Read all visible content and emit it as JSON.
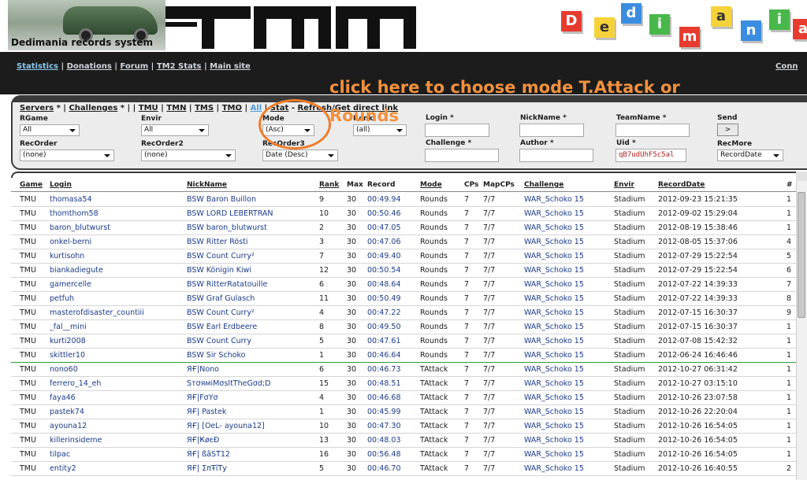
{
  "header": {
    "title": "Dedimania records system",
    "logo_text": "TMN",
    "dedimania_letters": [
      "D",
      "e",
      "d",
      "i",
      "m",
      "a",
      "n",
      "i",
      "a"
    ]
  },
  "nav": {
    "links": [
      "Statistics",
      "Donations",
      "Forum",
      "TM2 Stats",
      "Main site"
    ],
    "active": "Statistics",
    "right_link": "Conn"
  },
  "annotation": {
    "text": "click here to choose mode T.Attack or Rounds",
    "color": "#f2913d"
  },
  "panel": {
    "servers_label": "Servers",
    "challenges_label": "Challenges",
    "games": [
      "TMU",
      "TMN",
      "TMS",
      "TMO",
      "All"
    ],
    "current_game": "All",
    "stat_label": "Stat",
    "refresh_label": "Refresh/Get direct link",
    "filters": {
      "rgame": {
        "label": "RGame",
        "value": "All"
      },
      "envir": {
        "label": "Envir",
        "value": "All"
      },
      "mode": {
        "label": "Mode",
        "value": "(Asc)"
      },
      "rank": {
        "label": "Rank",
        "value": "(all)"
      },
      "login": {
        "label": "Login *",
        "value": ""
      },
      "nickname": {
        "label": "NickName *",
        "value": ""
      },
      "teamname": {
        "label": "TeamName *",
        "value": ""
      },
      "send": {
        "label": "Send",
        "button": ">"
      },
      "recorder": {
        "label": "RecOrder",
        "value": "(none)"
      },
      "recorder2": {
        "label": "RecOrder2",
        "value": "(none)"
      },
      "recorder3": {
        "label": "RecOrder3",
        "value": "Date (Desc)"
      },
      "challenge": {
        "label": "Challenge *",
        "value": ""
      },
      "author": {
        "label": "Author *",
        "value": ""
      },
      "uid": {
        "label": "Uid *",
        "value": "qB7udUhF5c5al"
      },
      "recmore": {
        "label": "RecMore",
        "value": "RecordDate"
      }
    }
  },
  "table": {
    "columns": [
      "Game",
      "Login",
      "NickName",
      "Rank",
      "Max",
      "Record",
      "Mode",
      "CPs",
      "MapCPs",
      "Challenge",
      "Envir",
      "RecordDate",
      "#"
    ],
    "rows": [
      [
        "TMU",
        "thomasa54",
        "BSW Baron Buillon",
        "9",
        "30",
        "00:49.94",
        "Rounds",
        "7",
        "7/7",
        "WAR_Schoko 15",
        "Stadium",
        "2012-09-23 15:21:35",
        "1"
      ],
      [
        "TMU",
        "thomthom58",
        "BSW LORD LEBERTRAN",
        "10",
        "30",
        "00:50.46",
        "Rounds",
        "7",
        "7/7",
        "WAR_Schoko 15",
        "Stadium",
        "2012-09-02 15:29:04",
        "1"
      ],
      [
        "TMU",
        "baron_blutwurst",
        "BSW baron_blutwurst",
        "2",
        "30",
        "00:47.05",
        "Rounds",
        "7",
        "7/7",
        "WAR_Schoko 15",
        "Stadium",
        "2012-08-19 15:38:46",
        "1"
      ],
      [
        "TMU",
        "onkel-berni",
        "BSW Ritter Rösti",
        "3",
        "30",
        "00:47.06",
        "Rounds",
        "7",
        "7/7",
        "WAR_Schoko 15",
        "Stadium",
        "2012-08-05 15:37:06",
        "4"
      ],
      [
        "TMU",
        "kurtisohn",
        "BSW Count Curry²",
        "7",
        "30",
        "00:49.40",
        "Rounds",
        "7",
        "7/7",
        "WAR_Schoko 15",
        "Stadium",
        "2012-07-29 15:22:54",
        "5"
      ],
      [
        "TMU",
        "biankadiegute",
        "BSW Königin Kiwi",
        "12",
        "30",
        "00:50.54",
        "Rounds",
        "7",
        "7/7",
        "WAR_Schoko 15",
        "Stadium",
        "2012-07-29 15:22:54",
        "6"
      ],
      [
        "TMU",
        "gamercelle",
        "BSW RitterRatatouille",
        "6",
        "30",
        "00:48.64",
        "Rounds",
        "7",
        "7/7",
        "WAR_Schoko 15",
        "Stadium",
        "2012-07-22 14:39:33",
        "7"
      ],
      [
        "TMU",
        "petfuh",
        "BSW Graf Gulasch",
        "11",
        "30",
        "00:50.49",
        "Rounds",
        "7",
        "7/7",
        "WAR_Schoko 15",
        "Stadium",
        "2012-07-22 14:39:33",
        "8"
      ],
      [
        "TMU",
        "masterofdisaster_countiii",
        "BSW Count Curry²",
        "4",
        "30",
        "00:47.22",
        "Rounds",
        "7",
        "7/7",
        "WAR_Schoko 15",
        "Stadium",
        "2012-07-15 16:30:37",
        "9"
      ],
      [
        "TMU",
        "_fal__mini",
        "BSW Earl Erdbeere",
        "8",
        "30",
        "00:49.50",
        "Rounds",
        "7",
        "7/7",
        "WAR_Schoko 15",
        "Stadium",
        "2012-07-15 16:30:37",
        "1"
      ],
      [
        "TMU",
        "kurti2008",
        "BSW Count Curry",
        "5",
        "30",
        "00:47.61",
        "Rounds",
        "7",
        "7/7",
        "WAR_Schoko 15",
        "Stadium",
        "2012-07-08 15:42:32",
        "1"
      ],
      [
        "TMU",
        "skittler10",
        "BSW Sir Schoko",
        "1",
        "30",
        "00:46.64",
        "Rounds",
        "7",
        "7/7",
        "WAR_Schoko 15",
        "Stadium",
        "2012-06-24 16:46:46",
        "1"
      ],
      [
        "TMU",
        "nono60",
        "ЯҒ|Nono",
        "6",
        "30",
        "00:46.73",
        "TAttack",
        "7",
        "7/7",
        "WAR_Schoko 15",
        "Stadium",
        "2012-10-27 06:31:42",
        "1"
      ],
      [
        "TMU",
        "ferrero_14_eh",
        "SтσямiMσsItTheGσd;D",
        "15",
        "30",
        "00:48.51",
        "TAttack",
        "7",
        "7/7",
        "WAR_Schoko 15",
        "Stadium",
        "2012-10-27 03:15:10",
        "1"
      ],
      [
        "TMU",
        "faya46",
        "ЯҒ|FσYσ",
        "4",
        "30",
        "00:46.68",
        "TAttack",
        "7",
        "7/7",
        "WAR_Schoko 15",
        "Stadium",
        "2012-10-26 23:07:58",
        "1"
      ],
      [
        "TMU",
        "pastek74",
        "ЯҒ| Pastek",
        "1",
        "30",
        "00:45.99",
        "TAttack",
        "7",
        "7/7",
        "WAR_Schoko 15",
        "Stadium",
        "2012-10-26 22:20:04",
        "1"
      ],
      [
        "TMU",
        "ayouna12",
        "ЯҒ| [OeL- ayouna12]",
        "10",
        "30",
        "00:47.30",
        "TAttack",
        "7",
        "7/7",
        "WAR_Schoko 15",
        "Stadium",
        "2012-10-26 16:54:05",
        "1"
      ],
      [
        "TMU",
        "killerinsideme",
        "ЯҒ|ҜøєĐ",
        "13",
        "30",
        "00:48.03",
        "TAttack",
        "7",
        "7/7",
        "WAR_Schoko 15",
        "Stadium",
        "2012-10-26 16:54:05",
        "1"
      ],
      [
        "TMU",
        "tilpac",
        "ЯҒ| ßâŠŤ12",
        "16",
        "30",
        "00:56.48",
        "TAttack",
        "7",
        "7/7",
        "WAR_Schoko 15",
        "Stadium",
        "2012-10-26 16:54:05",
        "1"
      ],
      [
        "TMU",
        "entity2",
        "ЯҒ| ΣπŦĩŤу",
        "5",
        "30",
        "00:46.70",
        "TAttack",
        "7",
        "7/7",
        "WAR_Schoko 15",
        "Stadium",
        "2012-10-26 16:40:55",
        "2"
      ]
    ]
  },
  "colors": {
    "accent": "#f2913d",
    "link_blue": "#1a3a8a",
    "active_link": "#8ccaf0",
    "dark_bar": "#1c1c1c"
  }
}
